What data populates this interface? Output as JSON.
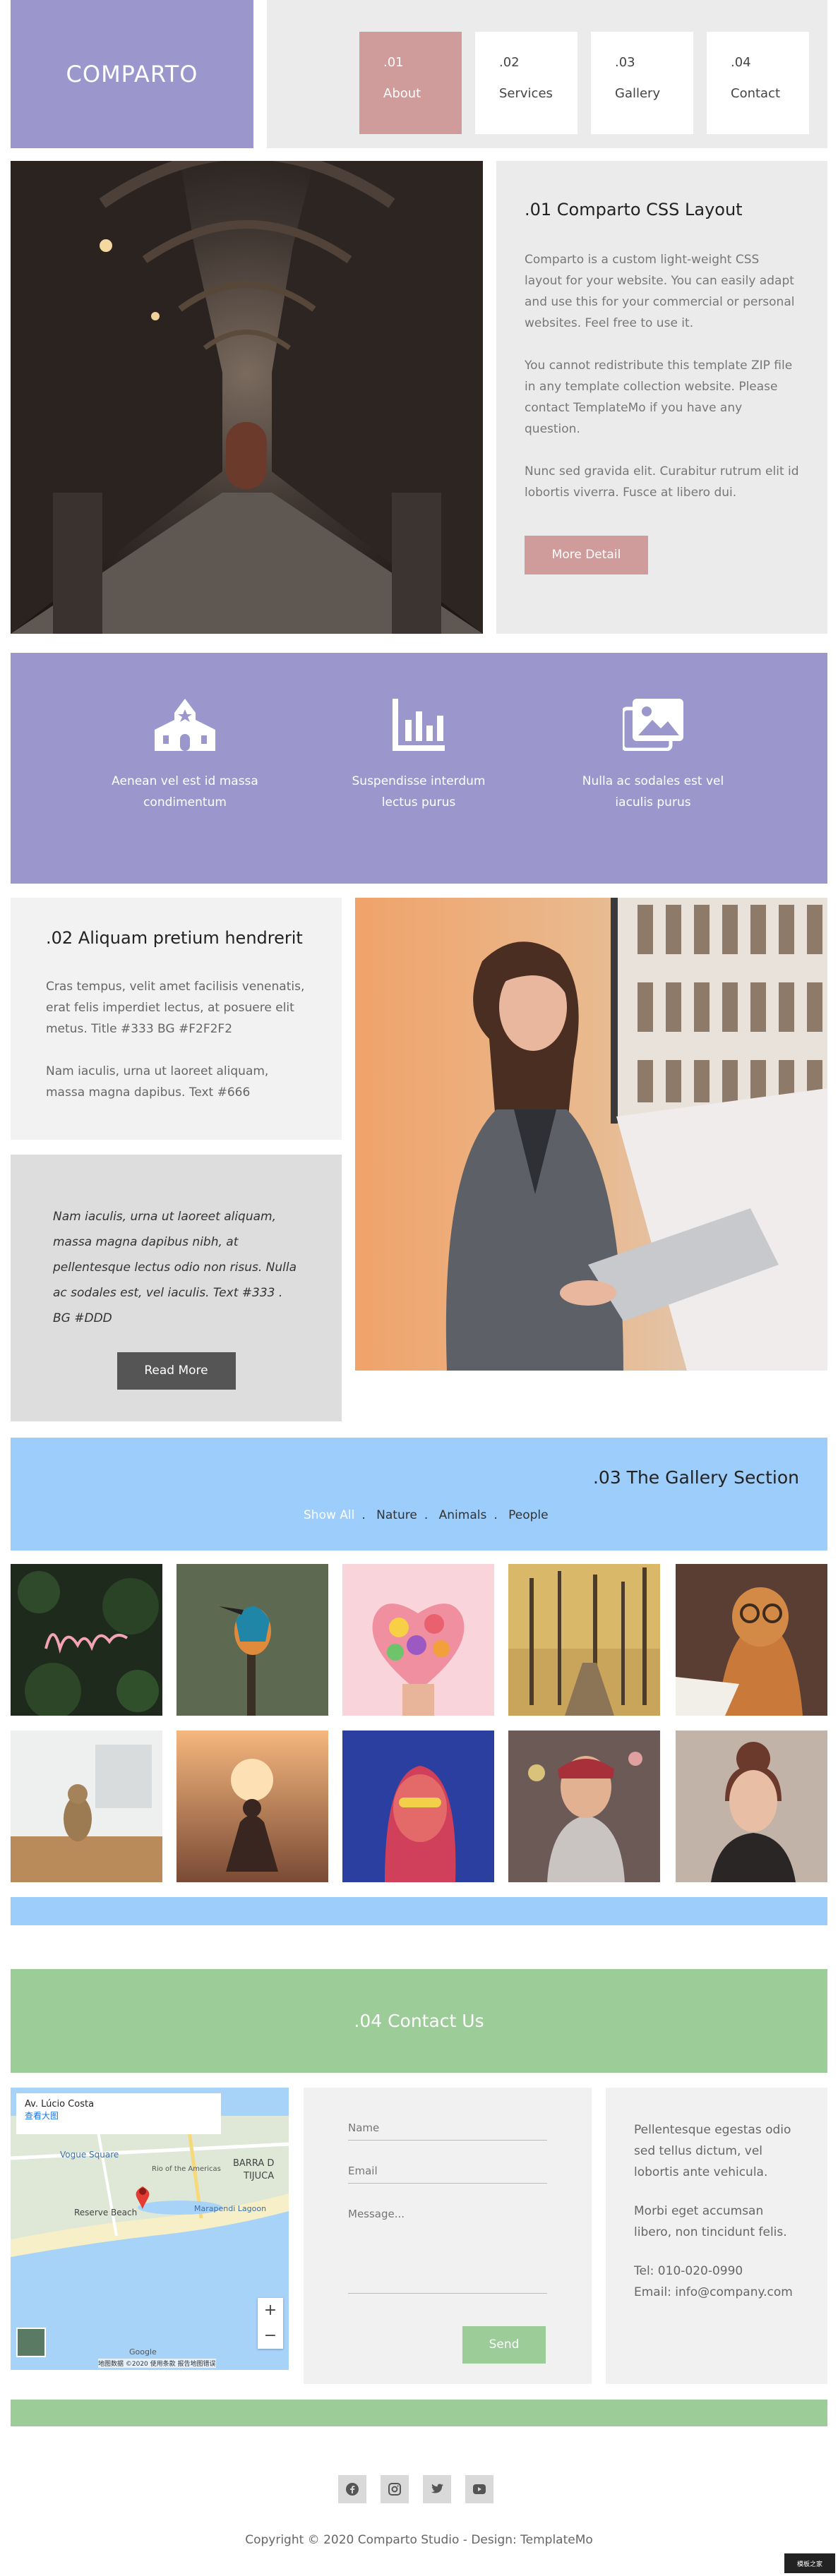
{
  "brand": {
    "name": "COMPARTO"
  },
  "nav": [
    {
      "num": ".01",
      "label": "About"
    },
    {
      "num": ".02",
      "label": "Services"
    },
    {
      "num": ".03",
      "label": "Gallery"
    },
    {
      "num": ".04",
      "label": "Contact"
    }
  ],
  "about": {
    "title": ".01 Comparto CSS Layout",
    "p1": "Comparto is a custom light-weight CSS layout for your website. You can easily adapt and use this for your commercial or personal websites. Feel free to use it.",
    "p2": "You cannot redistribute this template ZIP file in any template collection website. Please contact TemplateMo if you have any question.",
    "p3": "Nunc sed gravida elit. Curabitur rutrum elit id lobortis viverra. Fusce at libero dui.",
    "button": "More Detail"
  },
  "features": [
    {
      "icon": "church-icon",
      "text": "Aenean vel est id massa condimentum"
    },
    {
      "icon": "bar-chart-icon",
      "text": "Suspendisse interdum lectus purus"
    },
    {
      "icon": "images-icon",
      "text": "Nulla ac sodales est vel iaculis purus"
    }
  ],
  "section2": {
    "title": ".02 Aliquam pretium hendrerit",
    "p1": "Cras tempus, velit amet facilisis venenatis, erat felis imperdiet lectus, at posuere elit metus. Title #333 BG #F2F2F2",
    "p2": "Nam iaculis, urna ut laoreet aliquam, massa magna dapibus. Text #666",
    "quote": "Nam iaculis, urna ut laoreet aliquam, massa magna dapibus nibh, at pellentesque lectus odio non risus. Nulla ac sodales est, vel iaculis. Text #333 . BG #DDD",
    "button": "Read More"
  },
  "gallery": {
    "title": ".03 The Gallery Section",
    "filters": [
      "Show All",
      "Nature",
      "Animals",
      "People"
    ],
    "active_filter": "Show All"
  },
  "contact": {
    "title": ".04 Contact Us",
    "map": {
      "place": "Av. Lúcio Costa",
      "link": "查看大图",
      "labels": [
        "Vogue Square",
        "BARRA D",
        "TIJUCA",
        "Reserve Beach",
        "Rio of the Americas",
        "Marapendi Lagoon",
        "Google"
      ],
      "attribution": "地图数据 ©2020 使用条款 报告地图错误"
    },
    "form": {
      "name_placeholder": "Name",
      "email_placeholder": "Email",
      "message_placeholder": "Message...",
      "send": "Send"
    },
    "info": {
      "p1": "Pellentesque egestas odio sed tellus dictum, vel lobortis ante vehicula.",
      "p2": "Morbi eget accumsan libero, non tincidunt felis.",
      "tel": "Tel: 010-020-0990",
      "email": "Email: info@company.com"
    }
  },
  "footer": {
    "socials": [
      "facebook-icon",
      "instagram-icon",
      "twitter-icon",
      "youtube-icon"
    ],
    "copyright": "Copyright © 2020 Comparto Studio - Design: TemplateMo",
    "badge": "模板之家"
  },
  "colors": {
    "purple": "#9b97cc",
    "rose": "#d09b9b",
    "sky": "#9dcdfa",
    "green": "#9ccc98",
    "panel": "#ebebeb"
  }
}
